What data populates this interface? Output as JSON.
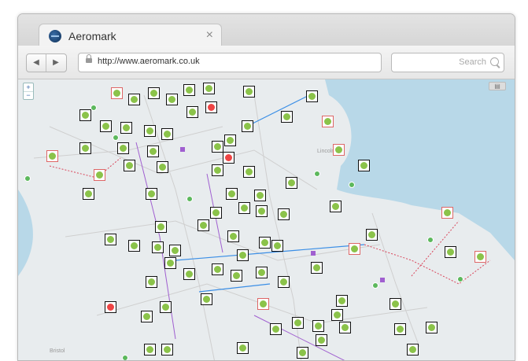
{
  "browser": {
    "tab_title": "Aeromark",
    "tab_close": "×",
    "back_label": "◀",
    "forward_label": "▶",
    "url": "http://www.aeromark.co.uk",
    "search_placeholder": "Search"
  },
  "map": {
    "zoom_in": "+",
    "zoom_out": "−",
    "layers_label": "▤",
    "place_labels": [
      "Lincoln",
      "Bristol"
    ],
    "colors": {
      "land": "#e8ecee",
      "sea": "#b8d8e8",
      "marker_border": "#111111",
      "marker_green": "#8bc34a",
      "marker_red": "#ee4444",
      "route_blue": "#3a8ee6",
      "route_purple": "#a05fd0",
      "route_red": "#d9455a"
    },
    "icons": [
      "camera-marker-icon",
      "alert-marker-icon",
      "waypoint-dot-icon"
    ]
  }
}
